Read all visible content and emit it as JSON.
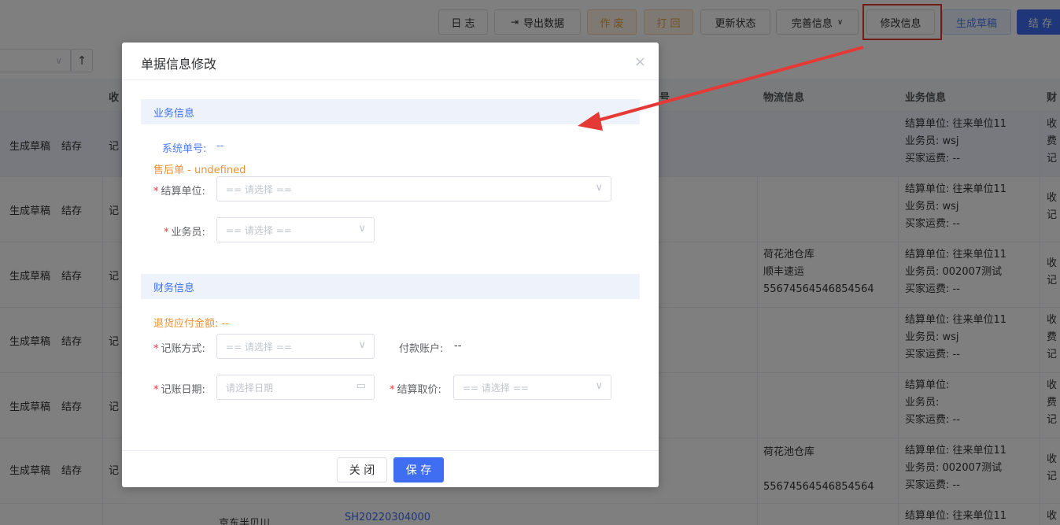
{
  "toolbar": {
    "log": "日 志",
    "export": "导出数据",
    "void": "作 废",
    "return": "打 回",
    "update_status": "更新状态",
    "complete_info": "完善信息",
    "modify_info": "修改信息",
    "gen_draft": "生成草稿",
    "settle": "结 存"
  },
  "table": {
    "headers": {
      "receive": "收",
      "logistics": "物流信息",
      "business": "业务信息",
      "finance": "财"
    },
    "header_no": "号",
    "rows": [
      {
        "actions": [
          "生成草稿",
          "结存"
        ],
        "receive": "记",
        "logistics": [],
        "business": [
          "结算单位: 往来单位11",
          "业务员: wsj",
          "买家运费: --"
        ],
        "finance": [
          "收",
          "费",
          "记"
        ]
      },
      {
        "actions": [
          "生成草稿",
          "结存"
        ],
        "receive": "记",
        "logistics": [],
        "business": [
          "结算单位: 往来单位11",
          "业务员: wsj",
          "买家运费: --"
        ],
        "finance": [
          "收",
          "记"
        ]
      },
      {
        "actions": [
          "生成草稿",
          "结存"
        ],
        "receive": "记",
        "logistics": [
          "荷花池仓库",
          "顺丰速运",
          "55674564546854564"
        ],
        "business": [
          "结算单位: 往来单位11",
          "业务员: 002007测试",
          "买家运费: --"
        ],
        "finance": [
          "收",
          "记"
        ]
      },
      {
        "actions": [
          "生成草稿",
          "结存"
        ],
        "receive": "记",
        "logistics": [],
        "business": [
          "结算单位: 往来单位11",
          "业务员: wsj",
          "买家运费: --"
        ],
        "finance": [
          "收",
          "费",
          "记"
        ]
      },
      {
        "actions": [
          "生成草稿",
          "结存"
        ],
        "receive": "记",
        "logistics": [],
        "business": [
          "结算单位:",
          "业务员:",
          "买家运费: --"
        ],
        "finance": [
          "收",
          "费",
          "记"
        ]
      },
      {
        "actions": [
          "生成草稿",
          "结存"
        ],
        "receive": "记",
        "logistics": [
          "荷花池仓库",
          "",
          "55674564546854564"
        ],
        "business": [
          "结算单位: 往来单位11",
          "业务员: 002007测试",
          "买家运费: --"
        ],
        "finance": [
          "收",
          "记"
        ]
      }
    ],
    "partial_row": {
      "middle": "京东半贝川",
      "link": "SH20220304000",
      "business": "结算单位: 往来单位11",
      "finance": "收"
    }
  },
  "dialog": {
    "title": "单据信息修改",
    "close_icon": "×",
    "section_business": "业务信息",
    "system_no_label": "系统单号:",
    "system_no_value": "--",
    "aftersale": "售后单 - undefined",
    "settle_unit_label": "结算单位:",
    "settle_unit_placeholder": "== 请选择 ==",
    "salesman_label": "业务员:",
    "salesman_placeholder": "== 请选择 ==",
    "section_finance": "财务信息",
    "refund_amount": "退货应付金额: --",
    "account_method_label": "记账方式:",
    "account_method_placeholder": "== 请选择 ==",
    "pay_account_label": "付款账户:",
    "pay_account_value": "--",
    "account_date_label": "记账日期:",
    "account_date_placeholder": "请选择日期",
    "settle_price_label": "结算取价:",
    "settle_price_placeholder": "== 请选择 ==",
    "btn_close": "关 闭",
    "btn_save": "保 存"
  },
  "colors": {
    "primary": "#3f6ef3",
    "warning": "#f0902f",
    "danger": "#e53935"
  }
}
